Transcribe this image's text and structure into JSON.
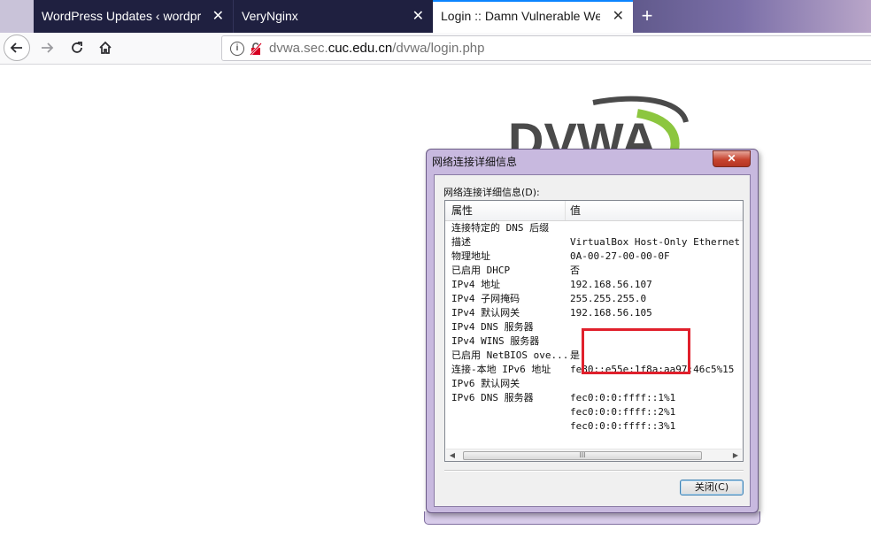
{
  "browser": {
    "tabs": [
      {
        "label": "WordPress Updates ‹ wordpress",
        "close": "✕"
      },
      {
        "label": "VeryNginx",
        "close": "✕"
      },
      {
        "label": "Login :: Damn Vulnerable Web A",
        "close": "✕"
      }
    ],
    "new_tab": "+",
    "url_prefix": "dvwa.sec.",
    "url_domain": "cuc.edu.cn",
    "url_path": "/dvwa/login.php"
  },
  "logo": {
    "text": "DVWA"
  },
  "dialog": {
    "title": "网络连接详细信息",
    "close_glyph": "✕",
    "group_label": "网络连接详细信息(D):",
    "columns": [
      "属性",
      "值"
    ],
    "rows": [
      {
        "property": "连接特定的 DNS 后缀",
        "value": ""
      },
      {
        "property": "描述",
        "value": "VirtualBox Host-Only Ethernet Adapter"
      },
      {
        "property": "物理地址",
        "value": "0A-00-27-00-00-0F"
      },
      {
        "property": "已启用 DHCP",
        "value": "否"
      },
      {
        "property": "IPv4 地址",
        "value": "192.168.56.107"
      },
      {
        "property": "IPv4 子网掩码",
        "value": "255.255.255.0"
      },
      {
        "property": "IPv4 默认网关",
        "value": "192.168.56.105"
      },
      {
        "property": "IPv4 DNS 服务器",
        "value": ""
      },
      {
        "property": "IPv4 WINS 服务器",
        "value": ""
      },
      {
        "property": "已启用 NetBIOS ove...",
        "value": "是"
      },
      {
        "property": "连接-本地 IPv6 地址",
        "value": "fe80::e55e:1f8a:aa97:46c5%15"
      },
      {
        "property": "IPv6 默认网关",
        "value": ""
      },
      {
        "property": "IPv6 DNS 服务器",
        "value": "fec0:0:0:ffff::1%1"
      },
      {
        "property": "",
        "value": "fec0:0:0:ffff::2%1"
      },
      {
        "property": "",
        "value": "fec0:0:0:ffff::3%1"
      }
    ],
    "scroll_thumb_grip": "III",
    "close_button": "关闭(C)"
  },
  "colors": {
    "highlight": "#e0202c",
    "tab_active_accent": "#0a84ff"
  }
}
